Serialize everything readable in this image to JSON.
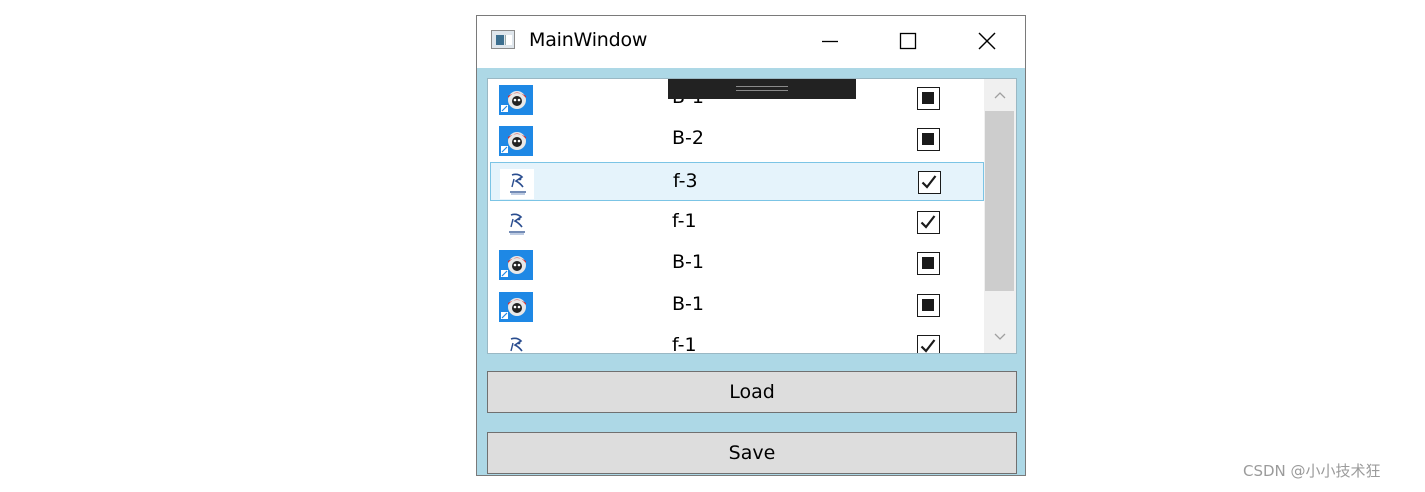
{
  "window": {
    "title": "MainWindow"
  },
  "list": {
    "items": [
      {
        "label": "B-1",
        "icon": "avatar-photo-icon",
        "state": "indeterminate",
        "selected": false
      },
      {
        "label": "B-2",
        "icon": "avatar-photo-icon",
        "state": "indeterminate",
        "selected": false
      },
      {
        "label": "f-3",
        "icon": "sketch-logo-icon",
        "state": "checked",
        "selected": true
      },
      {
        "label": "f-1",
        "icon": "sketch-logo-icon",
        "state": "checked",
        "selected": false
      },
      {
        "label": "B-1",
        "icon": "avatar-photo-icon",
        "state": "indeterminate",
        "selected": false
      },
      {
        "label": "B-1",
        "icon": "avatar-photo-icon",
        "state": "indeterminate",
        "selected": false
      },
      {
        "label": "f-1",
        "icon": "sketch-logo-icon",
        "state": "checked",
        "selected": false
      }
    ]
  },
  "buttons": {
    "load_label": "Load",
    "save_label": "Save"
  },
  "watermark": "CSDN @小小技术狂",
  "colors": {
    "client_background": "#add8e6",
    "selection_background": "#e5f3fb",
    "selection_border": "#7bc4e5",
    "button_background": "#dddddd"
  }
}
